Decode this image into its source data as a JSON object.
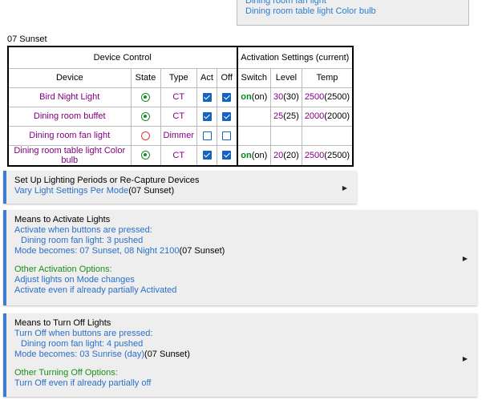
{
  "top_box": {
    "line1": "Dining room fan light",
    "line2": "Dining room table light Color bulb"
  },
  "mode_title": "07 Sunset",
  "table": {
    "group1": "Device Control",
    "group2": "Activation Settings (current)",
    "headers": [
      "Device",
      "State",
      "Type",
      "Act",
      "Off",
      "Switch",
      "Level",
      "Temp"
    ],
    "rows": [
      {
        "device": "Bird Night Light",
        "state": "on",
        "type": "CT",
        "act": true,
        "off": true,
        "switch_val": "on",
        "switch_cur": "(on)",
        "level_val": "30",
        "level_cur": "(30)",
        "temp_val": "2500",
        "temp_cur": "(2500)"
      },
      {
        "device": "Dining room buffet",
        "state": "on",
        "type": "CT",
        "act": true,
        "off": true,
        "switch_val": "",
        "switch_cur": "",
        "level_val": "25",
        "level_cur": "(25)",
        "temp_val": "2000",
        "temp_cur": "(2000)"
      },
      {
        "device": "Dining room fan light",
        "state": "off",
        "type": "Dimmer",
        "act": false,
        "off": false,
        "switch_val": "",
        "switch_cur": "",
        "level_val": "",
        "level_cur": "",
        "temp_val": "",
        "temp_cur": ""
      },
      {
        "device": "Dining room table light Color bulb",
        "state": "on",
        "type": "CT",
        "act": true,
        "off": true,
        "switch_val": "on",
        "switch_cur": "(on)",
        "level_val": "20",
        "level_cur": "(20)",
        "temp_val": "2500",
        "temp_cur": "(2500)"
      }
    ]
  },
  "panel1": {
    "title": "Set Up Lighting Periods or Re-Capture Devices",
    "link": "Vary Light Settings Per Mode",
    "suffix": "(07 Sunset)"
  },
  "panel2": {
    "title": "Means to Activate Lights",
    "link1": "Activate when buttons are pressed:",
    "link2": "Dining room fan light: 3 pushed",
    "link3": "Mode becomes: 07 Sunset, 08 Night 2100",
    "suffix": "(07 Sunset)",
    "other_title": "Other Activation Options:",
    "opt1": "Adjust lights on Mode changes",
    "opt2": "Activate even if already partially Activated"
  },
  "panel3": {
    "title": "Means to Turn Off Lights",
    "link1": "Turn Off when buttons are pressed:",
    "link2": "Dining room fan light: 4 pushed",
    "link3": "Mode becomes: 03 Sunrise (day)",
    "suffix": "(07 Sunset)",
    "other_title": "Other Turning Off Options:",
    "opt1": "Turn Off even if already partially off"
  },
  "icons": {
    "expand": "triangle-right-icon"
  },
  "colors": {
    "accent": "#3f7dd1",
    "link": "#2b6fc9",
    "device": "#800080",
    "on": "#00881b"
  }
}
